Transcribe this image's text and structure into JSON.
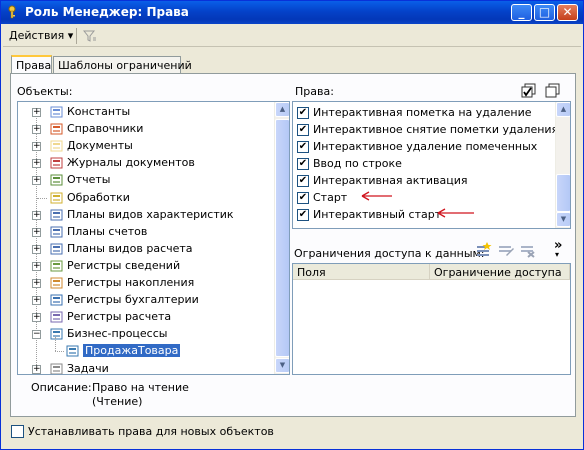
{
  "window": {
    "title": "Роль Менеджер: Права"
  },
  "menubar": {
    "actions_label": "Действия",
    "dropdown_glyph": "▾"
  },
  "tabs": [
    {
      "label": "Права"
    },
    {
      "label": "Шаблоны ограничений"
    }
  ],
  "objects": {
    "label": "Объекты:",
    "items": [
      {
        "label": "Константы",
        "icon": "constants-icon",
        "expander": "+"
      },
      {
        "label": "Справочники",
        "icon": "catalogs-icon",
        "expander": "+"
      },
      {
        "label": "Документы",
        "icon": "documents-icon",
        "expander": "+"
      },
      {
        "label": "Журналы документов",
        "icon": "journals-icon",
        "expander": "+"
      },
      {
        "label": "Отчеты",
        "icon": "reports-icon",
        "expander": "+"
      },
      {
        "label": "Обработки",
        "icon": "dataprocessors-icon",
        "expander": ""
      },
      {
        "label": "Планы видов характеристик",
        "icon": "charts-of-characteristic-types-icon",
        "expander": "+"
      },
      {
        "label": "Планы счетов",
        "icon": "charts-of-accounts-icon",
        "expander": "+"
      },
      {
        "label": "Планы видов расчета",
        "icon": "charts-of-calculation-types-icon",
        "expander": "+"
      },
      {
        "label": "Регистры сведений",
        "icon": "information-registers-icon",
        "expander": "+"
      },
      {
        "label": "Регистры накопления",
        "icon": "accumulation-registers-icon",
        "expander": "+"
      },
      {
        "label": "Регистры бухгалтерии",
        "icon": "accounting-registers-icon",
        "expander": "+"
      },
      {
        "label": "Регистры расчета",
        "icon": "calculation-registers-icon",
        "expander": "+"
      },
      {
        "label": "Бизнес-процессы",
        "icon": "business-processes-icon",
        "expander": "−"
      },
      {
        "label": "ПродажаТовара",
        "icon": "business-process-icon",
        "expander": "",
        "selected": true
      },
      {
        "label": "Задачи",
        "icon": "tasks-icon",
        "expander": "+"
      }
    ],
    "description_label": "Описание:",
    "description_line1": "Право на чтение",
    "description_line2": "(Чтение)"
  },
  "rights": {
    "label": "Права:",
    "items": [
      {
        "label": "Интерактивная пометка на удаление",
        "checked": true
      },
      {
        "label": "Интерактивное снятие пометки удаления",
        "checked": true
      },
      {
        "label": "Интерактивное удаление помеченных",
        "checked": true
      },
      {
        "label": "Ввод по строке",
        "checked": true
      },
      {
        "label": "Интерактивная активация",
        "checked": true
      },
      {
        "label": "Старт",
        "checked": true
      },
      {
        "label": "Интерактивный старт",
        "checked": true
      }
    ],
    "check_glyph": "✔"
  },
  "restrictions": {
    "label": "Ограничения доступа к данным:",
    "columns": [
      "Поля",
      "Ограничение доступа"
    ],
    "more_glyph": "»"
  },
  "footer": {
    "new_objects_label": "Устанавливать права для новых объектов",
    "new_objects_checked": false
  },
  "colors": {
    "accent": "#316ac5",
    "title_bar": "#0442c9",
    "annotation_arrow": "#d0141e"
  }
}
